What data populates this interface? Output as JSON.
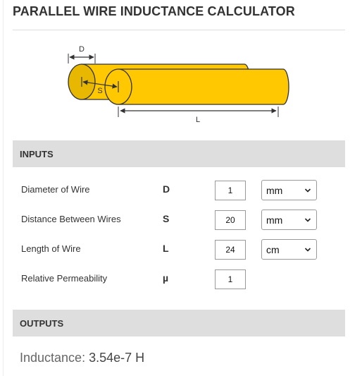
{
  "title": "PARALLEL WIRE INDUCTANCE CALCULATOR",
  "diagram": {
    "label_d": "D",
    "label_s": "S",
    "label_l": "L",
    "wire_color": "#FFC800",
    "wire_outline": "#333333"
  },
  "inputs": {
    "header": "INPUTS",
    "rows": [
      {
        "label": "Diameter of Wire",
        "symbol": "D",
        "value": "1",
        "unit": "mm"
      },
      {
        "label": "Distance Between Wires",
        "symbol": "S",
        "value": "20",
        "unit": "mm"
      },
      {
        "label": "Length of Wire",
        "symbol": "L",
        "value": "24",
        "unit": "cm"
      },
      {
        "label": "Relative Permeability",
        "symbol": "µ",
        "value": "1"
      }
    ]
  },
  "outputs": {
    "header": "OUTPUTS",
    "inductance_label": "Inductance:",
    "inductance_value": "3.54e-7 H"
  },
  "icons": {
    "select_arrow": "chevron-down-icon"
  }
}
